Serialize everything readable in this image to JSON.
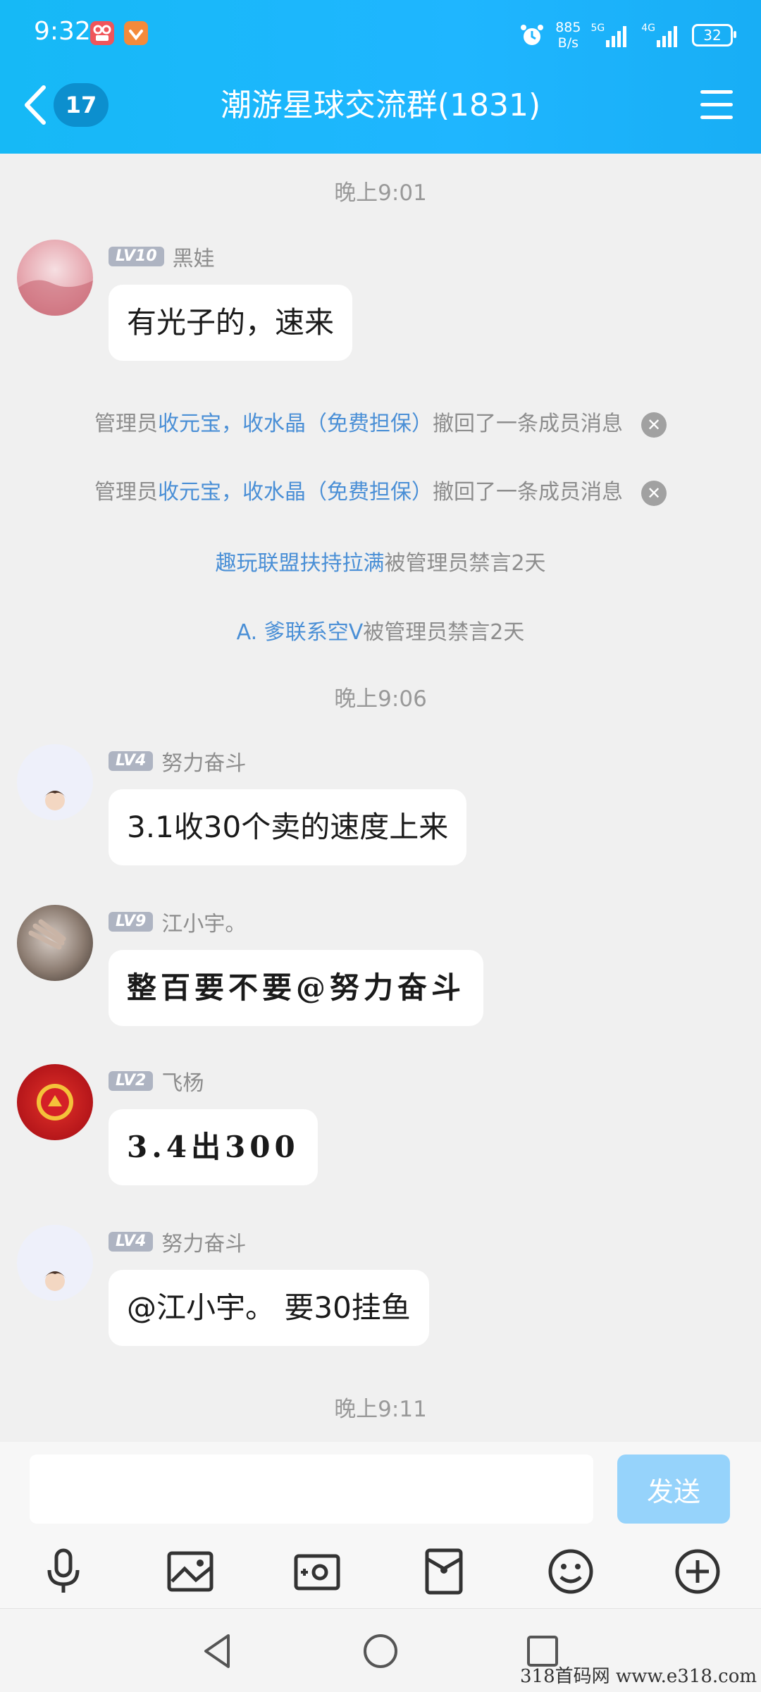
{
  "status_bar": {
    "time": "9:32",
    "net_speed_value": "885",
    "net_speed_unit": "B/s",
    "signal_1": "5G",
    "signal_2": "4G",
    "battery": "32"
  },
  "header": {
    "unread_count": "17",
    "title": "潮游星球交流群(1831)"
  },
  "timestamps": [
    "晚上9:01",
    "晚上9:06",
    "晚上9:11"
  ],
  "messages": [
    {
      "level": "LV10",
      "name": "黑娃",
      "text": "有光子的，速来"
    },
    {
      "level": "LV4",
      "name": "努力奋斗",
      "text": "3.1收30个卖的速度上来"
    },
    {
      "level": "LV9",
      "name": "江小宇。",
      "text": "整百要不要@努力奋斗"
    },
    {
      "level": "LV2",
      "name": "飞杨",
      "text": "3.4出300"
    },
    {
      "level": "LV4",
      "name": "努力奋斗",
      "text": "@江小宇。 要30挂鱼"
    }
  ],
  "system_notices": [
    {
      "prefix": "管理员",
      "highlight": "收元宝，收水晶（免费担保）",
      "suffix": "撤回了一条成员消息"
    },
    {
      "prefix": "管理员",
      "highlight": "收元宝，收水晶（免费担保）",
      "suffix": "撤回了一条成员消息"
    },
    {
      "prefix": "",
      "highlight": "趣玩联盟扶持拉满",
      "suffix": "被管理员禁言2天"
    },
    {
      "prefix": "",
      "highlight": "A. 爹联系空V",
      "suffix": "被管理员禁言2天"
    }
  ],
  "input": {
    "value": "",
    "send_label": "发送"
  },
  "toolbar_icons": [
    "microphone-icon",
    "image-icon",
    "camera-icon",
    "red-packet-icon",
    "emoji-icon",
    "plus-icon"
  ],
  "nav_icons": [
    "back-triangle-icon",
    "home-circle-icon",
    "recents-square-icon"
  ],
  "watermark": "318首码网  www.e318.com",
  "colors": {
    "header": "#1fb6ff",
    "link_blue": "#4a8fd6",
    "send_button": "#96d3fb",
    "chat_bg": "#f0f0f0"
  }
}
